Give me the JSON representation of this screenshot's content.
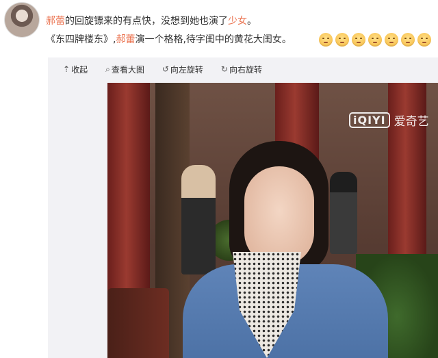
{
  "post": {
    "line1": [
      {
        "text": "郝蕾",
        "link": true
      },
      {
        "text": "的回旋镖来的有点快，没想到她也演了",
        "link": false
      },
      {
        "text": "少女",
        "link": true
      },
      {
        "text": "。",
        "link": false
      }
    ],
    "line2": [
      {
        "text": "《东四牌楼东》,",
        "link": false
      },
      {
        "text": "郝蕾",
        "link": true
      },
      {
        "text": "演一个格格,待字闺中的黄花大闺女。",
        "link": false
      }
    ],
    "emoji_names": [
      "smirk-emoji",
      "smirk-emoji",
      "smirk-emoji",
      "smirk-emoji",
      "smirk-emoji",
      "smirk-emoji",
      "smirk-emoji"
    ]
  },
  "toolbar": {
    "collapse_label": "收起",
    "collapse_icon": "arrow-up-icon",
    "view_large_label": "查看大图",
    "view_large_icon": "magnifier-icon",
    "rotate_left_label": "向左旋转",
    "rotate_left_icon": "rotate-left-icon",
    "rotate_right_label": "向右旋转",
    "rotate_right_icon": "rotate-right-icon"
  },
  "photo": {
    "watermark_logo": "iQIYI",
    "watermark_text": "爱奇艺"
  },
  "colors": {
    "link": "#eb7350",
    "panel_bg": "#f2f2f5"
  }
}
